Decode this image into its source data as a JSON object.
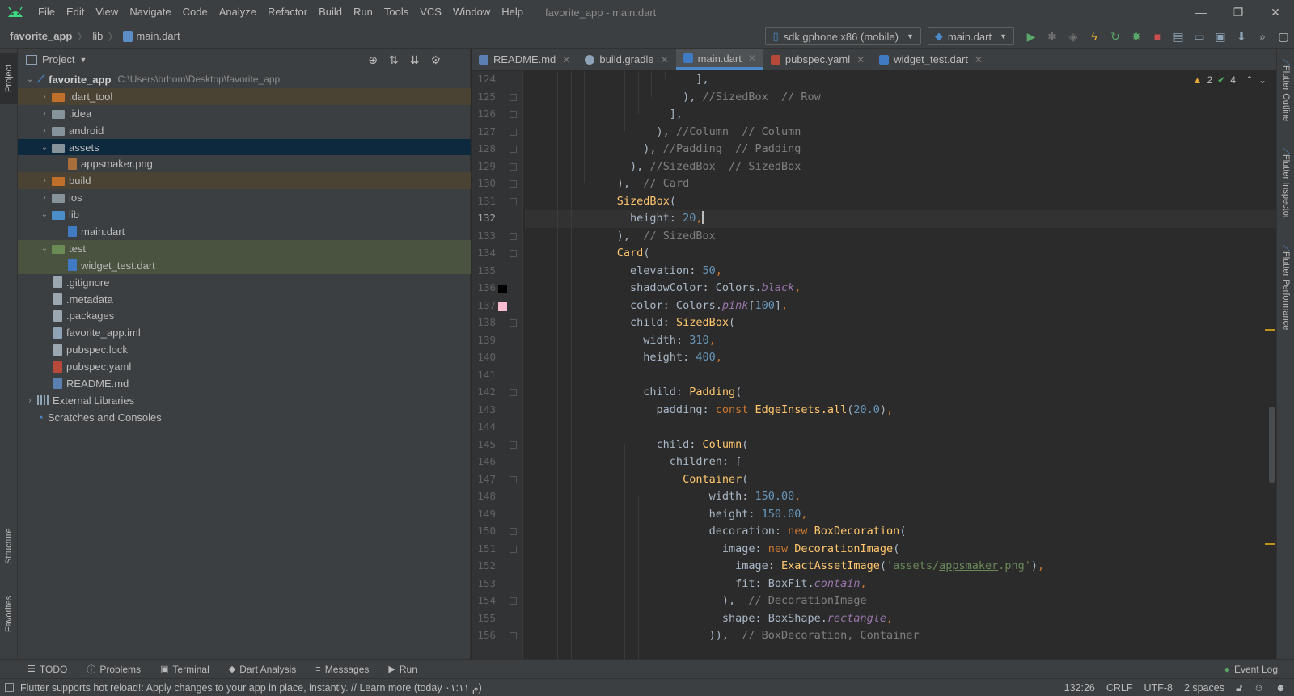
{
  "menubar": {
    "items": [
      "File",
      "Edit",
      "View",
      "Navigate",
      "Code",
      "Analyze",
      "Refactor",
      "Build",
      "Run",
      "Tools",
      "VCS",
      "Window",
      "Help"
    ],
    "window_title": "favorite_app - main.dart",
    "controls": [
      "—",
      "❐",
      "✕"
    ]
  },
  "navbar": {
    "crumbs": [
      "favorite_app",
      "lib",
      "main.dart"
    ],
    "device": "sdk gphone x86 (mobile)",
    "run_config": "main.dart"
  },
  "stripes": {
    "left": [
      "Project",
      "Structure",
      "Favorites"
    ],
    "right": [
      "Flutter Outline",
      "Flutter Inspector",
      "Flutter Performance"
    ]
  },
  "project_panel": {
    "title": "Project",
    "tree": [
      {
        "label": "favorite_app",
        "path": "C:\\Users\\brhom\\Desktop\\favorite_app"
      },
      {
        "label": ".dart_tool"
      },
      {
        "label": ".idea"
      },
      {
        "label": "android"
      },
      {
        "label": "assets"
      },
      {
        "label": "appsmaker.png"
      },
      {
        "label": "build"
      },
      {
        "label": "ios"
      },
      {
        "label": "lib"
      },
      {
        "label": "main.dart"
      },
      {
        "label": "test"
      },
      {
        "label": "widget_test.dart"
      },
      {
        "label": ".gitignore"
      },
      {
        "label": ".metadata"
      },
      {
        "label": ".packages"
      },
      {
        "label": "favorite_app.iml"
      },
      {
        "label": "pubspec.lock"
      },
      {
        "label": "pubspec.yaml"
      },
      {
        "label": "README.md"
      },
      {
        "label": "External Libraries"
      },
      {
        "label": "Scratches and Consoles"
      }
    ]
  },
  "editor": {
    "tabs": [
      "README.md",
      "build.gradle",
      "main.dart",
      "pubspec.yaml",
      "widget_test.dart"
    ],
    "active_tab": "main.dart",
    "warnings": "2",
    "ok_count": "4",
    "line_numbers": [
      "124",
      "125",
      "126",
      "127",
      "128",
      "129",
      "130",
      "131",
      "132",
      "133",
      "134",
      "135",
      "136",
      "137",
      "138",
      "139",
      "140",
      "141",
      "142",
      "143",
      "144",
      "145",
      "146",
      "147",
      "148",
      "149",
      "150",
      "151",
      "152",
      "153",
      "154",
      "155",
      "156"
    ],
    "current_line": "132",
    "swatch_colors": {
      "black": "#000000",
      "pink100": "#f8bbd0"
    }
  },
  "bottom_tools": [
    "TODO",
    "Problems",
    "Terminal",
    "Dart Analysis",
    "Messages",
    "Run"
  ],
  "event_log": "Event Log",
  "status": {
    "message": "Flutter supports hot reload!: Apply changes to your app in place, instantly. // Learn more (today م ٠١:١١)",
    "position": "132:26",
    "line_sep": "CRLF",
    "encoding": "UTF-8",
    "indent": "2 spaces"
  },
  "colors": {
    "accent": "#4a88c7",
    "selection": "#0d293e",
    "excluded": "#4a4334",
    "test_folder": "#49533f",
    "run_green": "#59a869",
    "stop_red": "#c94f4f"
  }
}
